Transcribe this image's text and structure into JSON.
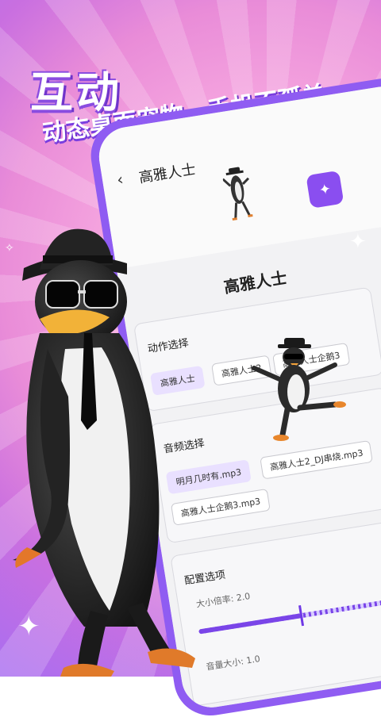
{
  "hero": {
    "headline": "互动",
    "subheadline": "动态桌面宠物，手机不孤单"
  },
  "app": {
    "back_icon": "‹",
    "title": "高雅人士",
    "fab_icon": "sparkle-icon",
    "sheet_title": "高雅人士",
    "action_section": {
      "label": "动作选择",
      "options": [
        "高雅人士",
        "高雅人士2",
        "高雅人士企鹅3"
      ],
      "selected": "高雅人士"
    },
    "audio_section": {
      "label": "音频选择",
      "options": [
        "明月几时有.mp3",
        "高雅人士2_DJ串烧.mp3",
        "高雅人士企鹅3.mp3"
      ],
      "selected": "明月几时有.mp3"
    },
    "config_section": {
      "label": "配置选项",
      "size_label": "大小倍率: 2.0",
      "size_fraction": 0.5,
      "volume_label": "音量大小: 1.0"
    }
  },
  "colors": {
    "accent": "#8a4ef0",
    "bg_pink": "#f2a6e0",
    "bg_purple": "#a96ef0"
  }
}
